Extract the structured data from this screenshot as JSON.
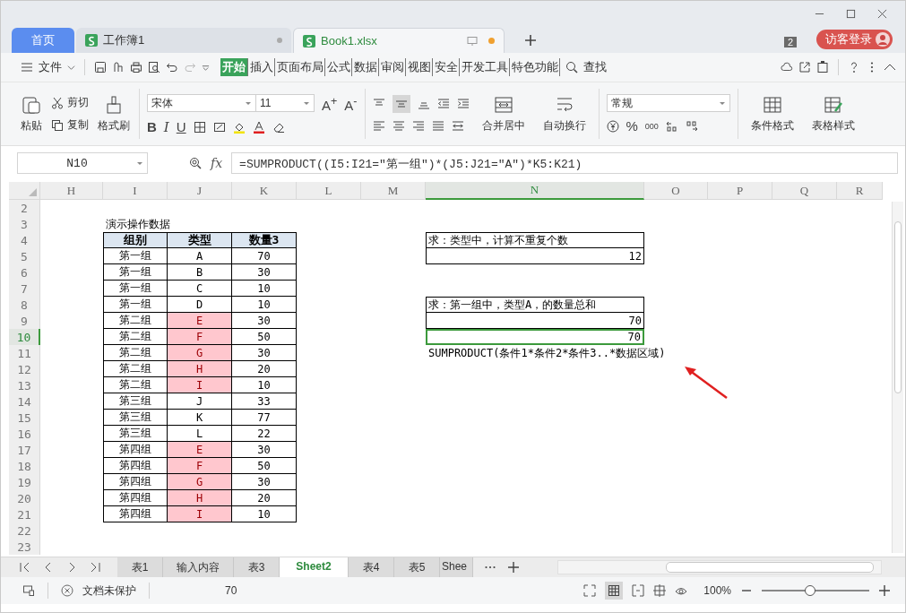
{
  "title_bar": {
    "tabs": [
      {
        "label": "首页",
        "kind": "home",
        "selected": false
      },
      {
        "label": "工作簿1",
        "kind": "doc",
        "selected": false,
        "modified": false
      },
      {
        "label": "Book1.xlsx",
        "kind": "doc",
        "selected": true,
        "modified": true
      }
    ],
    "window_count": "2",
    "login": "访客登录"
  },
  "menu": {
    "file": "文件",
    "items": [
      {
        "label": "开始",
        "selected": true
      },
      {
        "label": "插入",
        "selected": false
      },
      {
        "label": "页面布局",
        "selected": false
      },
      {
        "label": "公式",
        "selected": false
      },
      {
        "label": "数据",
        "selected": false
      },
      {
        "label": "审阅",
        "selected": false
      },
      {
        "label": "视图",
        "selected": false
      },
      {
        "label": "安全",
        "selected": false
      },
      {
        "label": "开发工具",
        "selected": false
      },
      {
        "label": "特色功能",
        "selected": false
      }
    ],
    "search": "查找"
  },
  "ribbon": {
    "paste": "粘贴",
    "cut": "剪切",
    "copy": "复制",
    "format_painter": "格式刷",
    "font": "宋体",
    "font_size": "11",
    "grow": "A$^{+}$",
    "shrink": "A$^{-}$",
    "bold": "B",
    "italic": "I",
    "underline": "U",
    "merge": "合并居中",
    "wrap": "自动换行",
    "number_format": "常规",
    "percent": "%",
    "thousands": "000",
    "conditional": "条件格式",
    "table_style": "表格样式"
  },
  "formula_bar": {
    "name_box": "N10",
    "fx": "fx",
    "formula": "=SUMPRODUCT((I5:I21=\"第一组\")*(J5:J21=\"A\")*K5:K21)"
  },
  "columns": [
    {
      "label": "H",
      "selected": false
    },
    {
      "label": "I",
      "selected": false
    },
    {
      "label": "J",
      "selected": false
    },
    {
      "label": "K",
      "selected": false
    },
    {
      "label": "L",
      "selected": false
    },
    {
      "label": "M",
      "selected": false
    },
    {
      "label": "N",
      "selected": true
    },
    {
      "label": "O",
      "selected": false
    },
    {
      "label": "P",
      "selected": false
    },
    {
      "label": "Q",
      "selected": false
    },
    {
      "label": "R",
      "selected": false
    }
  ],
  "rows": [
    {
      "label": "2",
      "selected": false
    },
    {
      "label": "3",
      "selected": false
    },
    {
      "label": "4",
      "selected": false
    },
    {
      "label": "5",
      "selected": false
    },
    {
      "label": "6",
      "selected": false
    },
    {
      "label": "7",
      "selected": false
    },
    {
      "label": "8",
      "selected": false
    },
    {
      "label": "9",
      "selected": false
    },
    {
      "label": "10",
      "selected": true
    },
    {
      "label": "11",
      "selected": false
    },
    {
      "label": "12",
      "selected": false
    },
    {
      "label": "13",
      "selected": false
    },
    {
      "label": "14",
      "selected": false
    },
    {
      "label": "15",
      "selected": false
    },
    {
      "label": "16",
      "selected": false
    },
    {
      "label": "17",
      "selected": false
    },
    {
      "label": "18",
      "selected": false
    },
    {
      "label": "19",
      "selected": false
    },
    {
      "label": "20",
      "selected": false
    },
    {
      "label": "21",
      "selected": false
    },
    {
      "label": "22",
      "selected": false
    },
    {
      "label": "23",
      "selected": false
    }
  ],
  "sheet": {
    "title": "演示操作数据",
    "headers": [
      "组别",
      "类型",
      "数量3"
    ],
    "records": [
      {
        "group": "第一组",
        "type": "A",
        "qty": "70",
        "highlighted": false
      },
      {
        "group": "第一组",
        "type": "B",
        "qty": "30",
        "highlighted": false
      },
      {
        "group": "第一组",
        "type": "C",
        "qty": "10",
        "highlighted": false
      },
      {
        "group": "第一组",
        "type": "D",
        "qty": "10",
        "highlighted": false
      },
      {
        "group": "第二组",
        "type": "E",
        "qty": "30",
        "highlighted": true
      },
      {
        "group": "第二组",
        "type": "F",
        "qty": "50",
        "highlighted": true
      },
      {
        "group": "第二组",
        "type": "G",
        "qty": "30",
        "highlighted": true
      },
      {
        "group": "第二组",
        "type": "H",
        "qty": "20",
        "highlighted": true
      },
      {
        "group": "第二组",
        "type": "I",
        "qty": "10",
        "highlighted": true
      },
      {
        "group": "第三组",
        "type": "J",
        "qty": "33",
        "highlighted": false
      },
      {
        "group": "第三组",
        "type": "K",
        "qty": "77",
        "highlighted": false
      },
      {
        "group": "第三组",
        "type": "L",
        "qty": "22",
        "highlighted": false
      },
      {
        "group": "第四组",
        "type": "E",
        "qty": "30",
        "highlighted": true
      },
      {
        "group": "第四组",
        "type": "F",
        "qty": "50",
        "highlighted": true
      },
      {
        "group": "第四组",
        "type": "G",
        "qty": "30",
        "highlighted": true
      },
      {
        "group": "第四组",
        "type": "H",
        "qty": "20",
        "highlighted": true
      },
      {
        "group": "第四组",
        "type": "I",
        "qty": "10",
        "highlighted": true
      }
    ]
  },
  "notes": [
    {
      "question": "求：类型中，计算不重复个数",
      "answers": [
        {
          "text": "12",
          "selected": false
        }
      ]
    },
    {
      "question": "求：第一组中，类型A，的数量总和",
      "answers": [
        {
          "text": "70",
          "selected": false
        },
        {
          "text": "70",
          "selected": true
        }
      ],
      "hint": "SUMPRODUCT(条件1*条件2*条件3..*数据区域)"
    }
  ],
  "sheet_tabs": [
    {
      "label": "表1",
      "selected": false
    },
    {
      "label": "输入内容",
      "selected": false
    },
    {
      "label": "表3",
      "selected": false
    },
    {
      "label": "Sheet2",
      "selected": true
    },
    {
      "label": "表4",
      "selected": false
    },
    {
      "label": "表5",
      "selected": false
    },
    {
      "label": "Shee",
      "selected": false
    }
  ],
  "status_bar": {
    "protection": "文档未保护",
    "sum": "70",
    "zoom": "100%",
    "zoom_slider": {
      "level": 0.45
    }
  }
}
